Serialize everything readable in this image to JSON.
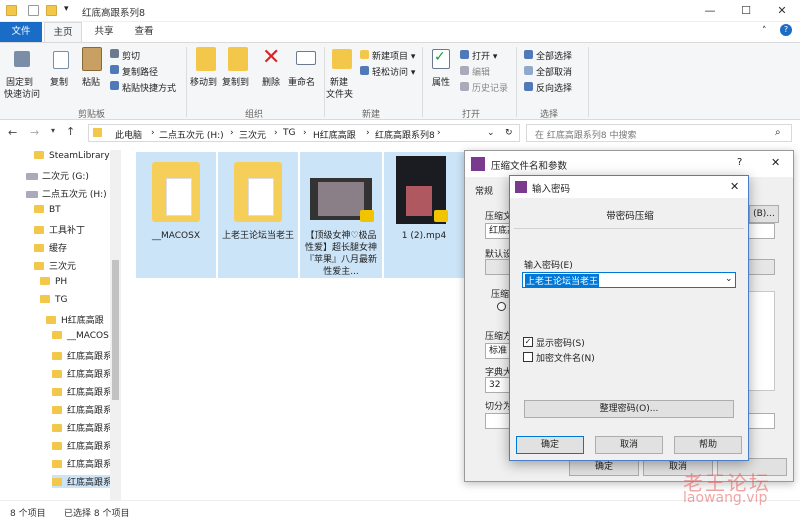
{
  "window": {
    "title": "红底高跟系列8",
    "minimize": "—",
    "maximize": "☐",
    "close": "✕",
    "help": "?"
  },
  "ribbon_tabs": {
    "file": "文件",
    "home": "主页",
    "share": "共享",
    "view": "查看"
  },
  "ribbon": {
    "pin": "固定到",
    "pin2": "快速访问",
    "copy": "复制",
    "paste": "粘贴",
    "cut": "剪切",
    "copy_path": "复制路径",
    "paste_shortcut": "粘贴快捷方式",
    "clipboard_group": "剪贴板",
    "move_to": "移动到",
    "copy_to": "复制到",
    "delete": "删除",
    "rename": "重命名",
    "organize_group": "组织",
    "new_folder": "新建",
    "new_folder2": "文件夹",
    "new_item": "新建项目 ▾",
    "easy_access": "轻松访问 ▾",
    "new_group": "新建",
    "properties": "属性",
    "open": "打开 ▾",
    "edit": "编辑",
    "history": "历史记录",
    "open_group": "打开",
    "select_all": "全部选择",
    "select_none": "全部取消",
    "invert": "反向选择",
    "select_group": "选择"
  },
  "breadcrumb": [
    "此电脑",
    "二点五次元 (H:)",
    "三次元",
    "TG",
    "H红底高跟",
    "红底高跟系列8"
  ],
  "search": {
    "placeholder": "在 红底高跟系列8 中搜索"
  },
  "nav_tree": [
    "SteamLibrary",
    "二次元 (G:)",
    "二点五次元 (H:)",
    "BT",
    "工具补丁",
    "缓存",
    "三次元",
    "PH",
    "TG",
    "H红底高跟",
    "__MACOS",
    "红底高跟系",
    "红底高跟系",
    "红底高跟系",
    "红底高跟系",
    "红底高跟系",
    "红底高跟系",
    "红底高跟系",
    "红底高跟系"
  ],
  "files": [
    {
      "name": "__MACOSX"
    },
    {
      "name": "上老王论坛当老王"
    },
    {
      "name": "【顶级女神♡极品性爱】超长腿女神『苹果』八月最新性爱主..."
    },
    {
      "name": "1 (2).mp4"
    }
  ],
  "status": {
    "count": "8 个项目",
    "selected": "已选择 8 个项目"
  },
  "winrar_dialog": {
    "title": "压缩文件名和参数",
    "tab_general": "常规",
    "label_archive": "压缩文",
    "archive_value": "红底高",
    "browse": "(B)...",
    "label_default": "默认设",
    "label_format": "压缩",
    "label_method": "压缩方",
    "method_value": "标准",
    "label_dict": "字典大",
    "dict_value": "32",
    "label_split": "切分为",
    "ok": "确定",
    "cancel": "取消"
  },
  "password_dialog": {
    "title": "输入密码",
    "heading": "带密码压缩",
    "label": "输入密码(E)",
    "value": "上老王论坛当老王",
    "show_password": "显示密码(S)",
    "encrypt_names": "加密文件名(N)",
    "organize": "整理密码(O)...",
    "ok": "确定",
    "cancel": "取消",
    "help": "帮助"
  },
  "watermark": {
    "cn": "老王论坛",
    "url": "laowang.vip"
  }
}
